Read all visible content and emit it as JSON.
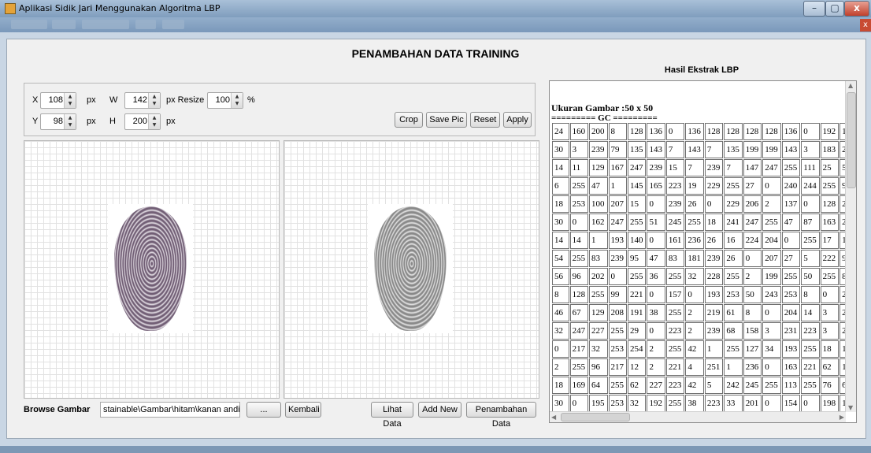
{
  "window": {
    "title": "Aplikasi Sidik Jari Menggunakan Algoritma LBP"
  },
  "page": {
    "title": "PENAMBAHAN DATA TRAINING"
  },
  "crop": {
    "x_label": "X",
    "x_value": "108",
    "y_label": "Y",
    "y_value": "98",
    "w_label": "W",
    "w_value": "142",
    "h_label": "H",
    "h_value": "200",
    "unit_px": "px",
    "resize_label": "px Resize",
    "resize_value": "100",
    "unit_pct": "%"
  },
  "buttons": {
    "crop": "Crop",
    "save_pic": "Save Pic",
    "reset": "Reset",
    "apply": "Apply",
    "browse": "...",
    "kembali": "Kembali",
    "lihat_data": "Lihat Data",
    "add_new": "Add New",
    "penambahan_data": "Penambahan Data"
  },
  "browse": {
    "label": "Browse Gambar",
    "path": "stainable\\Gambar\\hitam\\kanan andi.jpg"
  },
  "lbp": {
    "title": "Hasil Ekstrak LBP",
    "size_text": "Ukuran Gambar :50 x 50",
    "separator": "========= GC =========",
    "rows": [
      [
        "24",
        "160",
        "200",
        "8",
        "128",
        "136",
        "0",
        "136",
        "128",
        "128",
        "128",
        "128",
        "136",
        "0",
        "192",
        "1"
      ],
      [
        "30",
        "3",
        "239",
        "79",
        "135",
        "143",
        "7",
        "143",
        "7",
        "135",
        "199",
        "199",
        "143",
        "3",
        "183",
        "2"
      ],
      [
        "14",
        "11",
        "129",
        "167",
        "247",
        "239",
        "15",
        "7",
        "239",
        "7",
        "147",
        "247",
        "255",
        "111",
        "25",
        "5"
      ],
      [
        "6",
        "255",
        "47",
        "1",
        "145",
        "165",
        "223",
        "19",
        "229",
        "255",
        "27",
        "0",
        "240",
        "244",
        "255",
        "9"
      ],
      [
        "18",
        "253",
        "100",
        "207",
        "15",
        "0",
        "239",
        "26",
        "0",
        "229",
        "206",
        "2",
        "137",
        "0",
        "128",
        "2"
      ],
      [
        "30",
        "0",
        "162",
        "247",
        "255",
        "51",
        "245",
        "255",
        "18",
        "241",
        "247",
        "255",
        "47",
        "87",
        "163",
        "2"
      ],
      [
        "14",
        "14",
        "1",
        "193",
        "140",
        "0",
        "161",
        "236",
        "26",
        "16",
        "224",
        "204",
        "0",
        "255",
        "17",
        "1"
      ],
      [
        "54",
        "255",
        "83",
        "239",
        "95",
        "47",
        "83",
        "181",
        "239",
        "26",
        "0",
        "207",
        "27",
        "5",
        "222",
        "9"
      ],
      [
        "56",
        "96",
        "202",
        "0",
        "255",
        "36",
        "255",
        "32",
        "228",
        "255",
        "2",
        "199",
        "255",
        "50",
        "255",
        "8"
      ],
      [
        "8",
        "128",
        "255",
        "99",
        "221",
        "0",
        "157",
        "0",
        "193",
        "253",
        "50",
        "243",
        "253",
        "8",
        "0",
        "2"
      ],
      [
        "46",
        "67",
        "129",
        "208",
        "191",
        "38",
        "255",
        "2",
        "219",
        "61",
        "8",
        "0",
        "204",
        "14",
        "3",
        "2"
      ],
      [
        "32",
        "247",
        "227",
        "255",
        "29",
        "0",
        "223",
        "2",
        "239",
        "68",
        "158",
        "3",
        "231",
        "223",
        "3",
        "2"
      ],
      [
        "0",
        "217",
        "32",
        "253",
        "254",
        "2",
        "255",
        "42",
        "1",
        "255",
        "127",
        "34",
        "193",
        "255",
        "18",
        "1"
      ],
      [
        "2",
        "255",
        "96",
        "217",
        "12",
        "2",
        "221",
        "4",
        "251",
        "1",
        "236",
        "0",
        "163",
        "221",
        "62",
        "1"
      ],
      [
        "18",
        "169",
        "64",
        "255",
        "62",
        "227",
        "223",
        "42",
        "5",
        "242",
        "245",
        "255",
        "113",
        "255",
        "76",
        "6"
      ],
      [
        "30",
        "0",
        "195",
        "253",
        "32",
        "192",
        "255",
        "38",
        "223",
        "33",
        "201",
        "0",
        "154",
        "0",
        "198",
        "1"
      ]
    ]
  }
}
